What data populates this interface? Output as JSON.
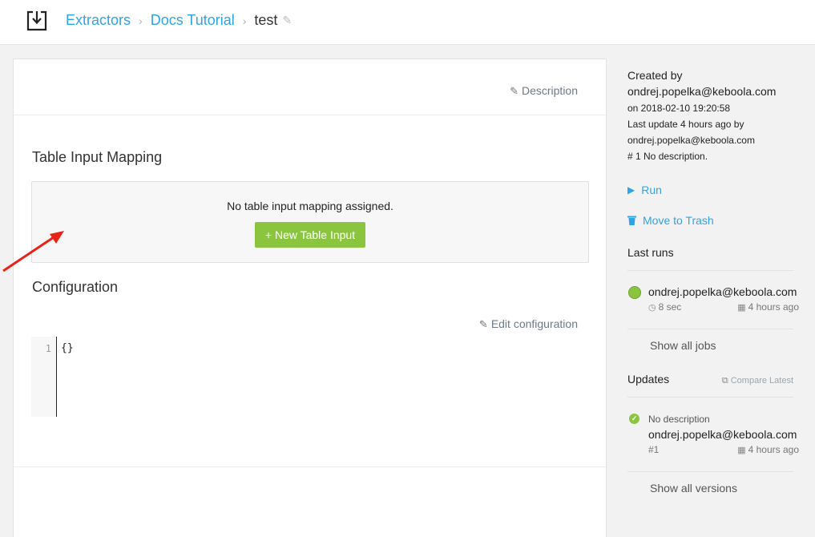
{
  "breadcrumb": {
    "items": [
      "Extractors",
      "Docs Tutorial"
    ],
    "separator": "›",
    "current": "test"
  },
  "main": {
    "description_label": "Description",
    "table_input_mapping": {
      "title": "Table Input Mapping",
      "empty_message": "No table input mapping assigned.",
      "new_button_label": "+ New Table Input"
    },
    "configuration": {
      "title": "Configuration",
      "edit_label": "Edit configuration",
      "code": {
        "line_number": "1",
        "content": "{}"
      }
    }
  },
  "sidebar": {
    "created_by_label": "Created by",
    "created_by_user": "ondrej.popelka@keboola.com",
    "created_on": "on 2018-02-10 19:20:58",
    "last_update": "Last update 4 hours ago by",
    "last_update_user": "ondrej.popelka@keboola.com",
    "version_note": "# 1 No description.",
    "run_label": "Run",
    "trash_label": "Move to Trash",
    "last_runs": {
      "heading": "Last runs",
      "items": [
        {
          "user": "ondrej.popelka@keboola.com",
          "duration": "8 sec",
          "when": "4 hours ago",
          "status": "success"
        }
      ],
      "show_all_label": "Show all jobs"
    },
    "updates": {
      "heading": "Updates",
      "compare_label": "Compare Latest",
      "items": [
        {
          "description": "No description",
          "user": "ondrej.popelka@keboola.com",
          "version": "#1",
          "when": "4 hours ago"
        }
      ],
      "show_all_label": "Show all versions"
    }
  },
  "icons": {
    "app": "download-box-icon",
    "edit": "pencil-icon",
    "run": "play-icon",
    "trash": "trash-icon",
    "clock": "clock-icon",
    "calendar": "calendar-icon",
    "compare": "copy-icon",
    "success": "check-circle-icon"
  },
  "colors": {
    "link": "#2fa4e7",
    "success": "#8bc53f",
    "annotation_arrow": "#e8231a"
  }
}
